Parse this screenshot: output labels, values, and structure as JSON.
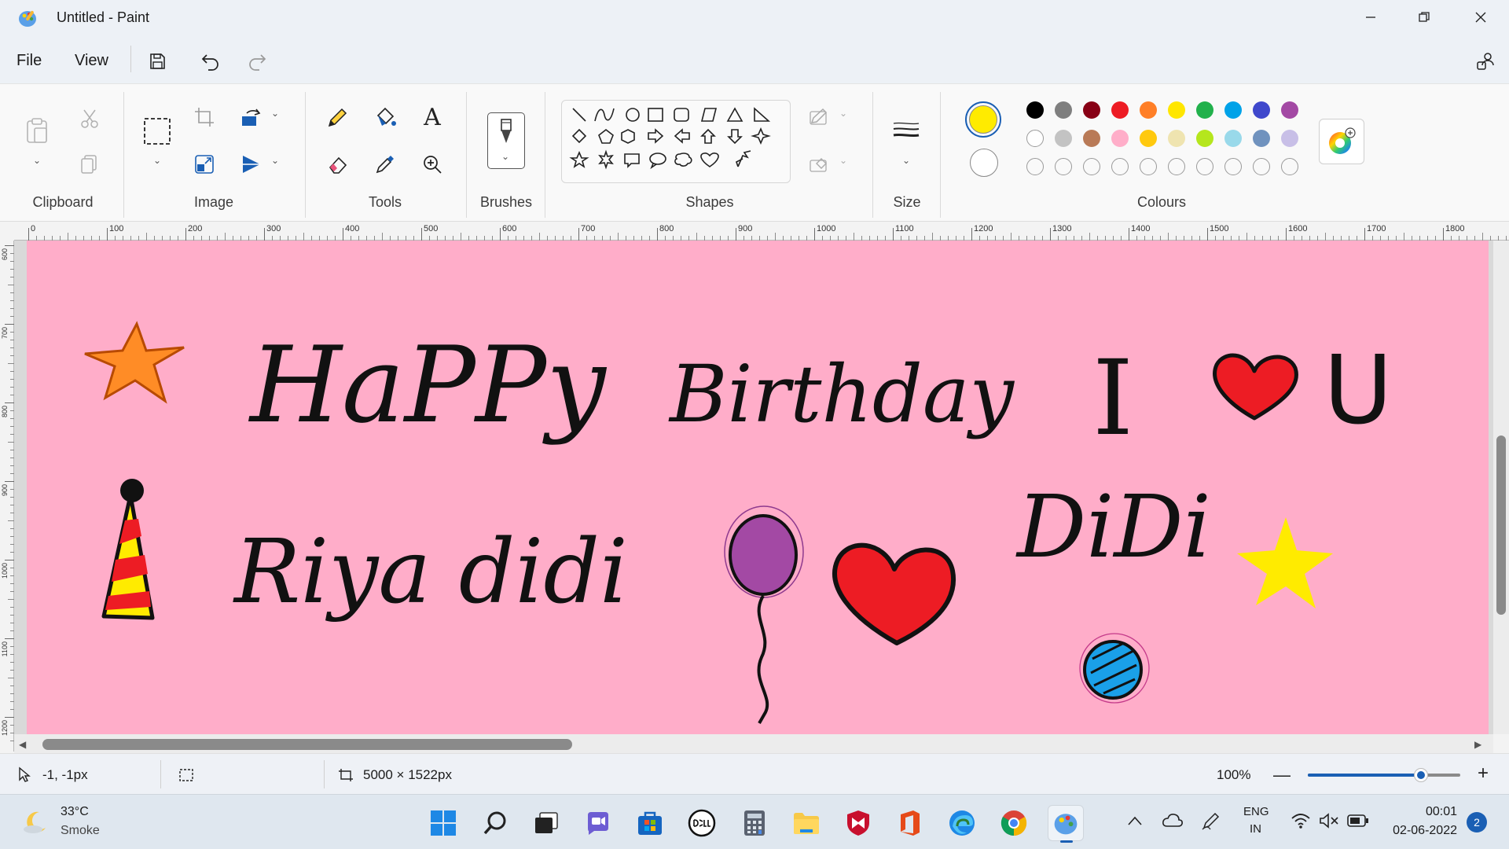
{
  "window": {
    "title": "Untitled - Paint"
  },
  "menu": {
    "file": "File",
    "view": "View"
  },
  "ribbon": {
    "groups": {
      "clipboard": "Clipboard",
      "image": "Image",
      "tools": "Tools",
      "brushes": "Brushes",
      "shapes": "Shapes",
      "size": "Size",
      "colours": "Colours"
    },
    "text_tool_glyph": "A",
    "primary_colour": "#ffeb00",
    "secondary_colour": "#ffffff",
    "palette_row1": [
      "#000000",
      "#7f7f7f",
      "#880015",
      "#ed1c24",
      "#ff7f27",
      "#ffe600",
      "#22b14c",
      "#00a2e8",
      "#3f48cc",
      "#a349a4"
    ],
    "palette_row2": [
      "#ffffff",
      "#c3c3c3",
      "#b97a57",
      "#ffaec9",
      "#ffc90e",
      "#efe4b0",
      "#b5e61d",
      "#99d9ea",
      "#7092be",
      "#c8bfe7"
    ],
    "palette_row3_empty": 10
  },
  "ruler": {
    "labels": [
      "0",
      "100",
      "200",
      "300",
      "400",
      "500",
      "600",
      "700",
      "800",
      "900",
      "1000",
      "1100",
      "1200",
      "1300",
      "1400",
      "1500",
      "1600",
      "1700",
      "1800"
    ],
    "vlabels": [
      "600",
      "700",
      "800",
      "900",
      "1000",
      "1100",
      "1200"
    ]
  },
  "canvas": {
    "background": "#ffadc9",
    "texts": {
      "happy": "HaPPy",
      "birthday": "Birthday",
      "i": "I",
      "u": "U",
      "riya": "Riya didi",
      "didi": "DiDi"
    }
  },
  "status": {
    "cursor_pos": "-1, -1px",
    "canvas_size": "5000 × 1522px",
    "zoom": "100%",
    "zoom_level": 0.74
  },
  "taskbar": {
    "weather_temp": "33°C",
    "weather_desc": "Smoke",
    "lang_line1": "ENG",
    "lang_line2": "IN",
    "time": "00:01",
    "date": "02-06-2022",
    "notifications": "2"
  }
}
